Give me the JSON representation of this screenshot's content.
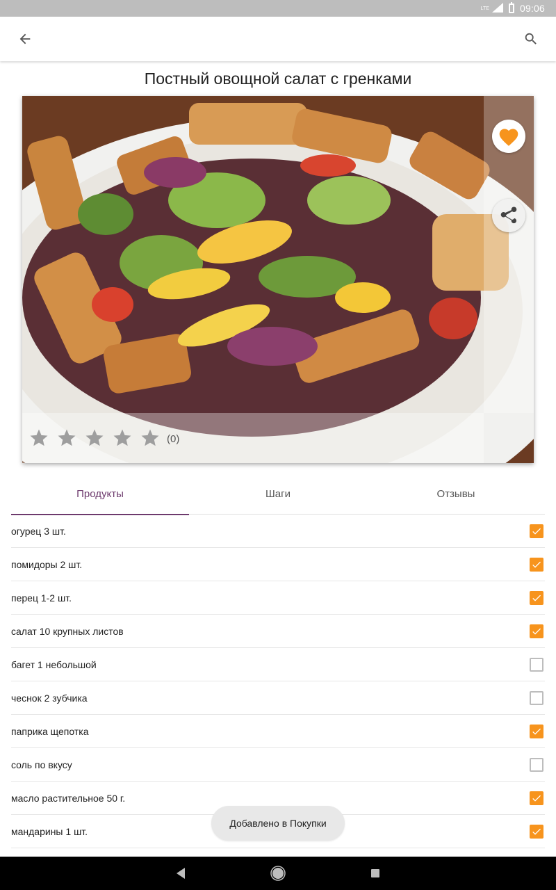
{
  "status_bar": {
    "network_label": "LTE",
    "time": "09:06"
  },
  "app_bar": {
    "back_icon": "arrow-back-icon",
    "search_icon": "search-icon"
  },
  "recipe": {
    "title": "Постный овощной салат с гренками",
    "rating": {
      "stars_filled": 0,
      "stars_total": 5,
      "count_label": "(0)"
    },
    "favorite_icon": "heart-icon",
    "share_icon": "share-icon"
  },
  "tabs": [
    {
      "label": "Продукты",
      "active": true
    },
    {
      "label": "Шаги",
      "active": false
    },
    {
      "label": "Отзывы",
      "active": false
    }
  ],
  "ingredients": [
    {
      "label": "огурец 3 шт.",
      "checked": true
    },
    {
      "label": "помидоры 2 шт.",
      "checked": true
    },
    {
      "label": "перец 1-2 шт.",
      "checked": true
    },
    {
      "label": "салат 10 крупных листов",
      "checked": true
    },
    {
      "label": "багет 1 небольшой",
      "checked": false
    },
    {
      "label": "чеснок 2 зубчика",
      "checked": false
    },
    {
      "label": "паприка щепотка",
      "checked": true
    },
    {
      "label": "соль по вкусу",
      "checked": false
    },
    {
      "label": "масло растительное 50 г.",
      "checked": true
    },
    {
      "label": "мандарины 1 шт.",
      "checked": true
    }
  ],
  "toast": {
    "message": "Добавлено в Покупки"
  },
  "colors": {
    "accent": "#f7941d",
    "tab_active": "#6d3a6d",
    "status_bar": "#bdbdbd",
    "nav_bar": "#000000"
  }
}
